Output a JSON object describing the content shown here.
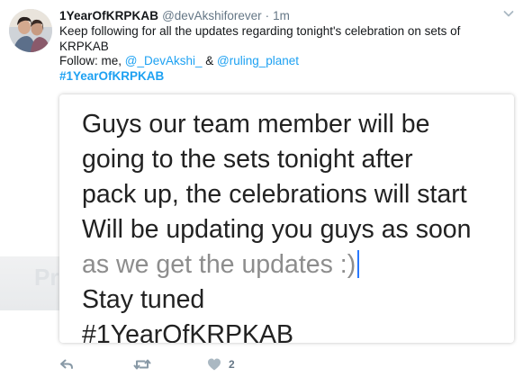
{
  "tweet": {
    "display_name": "1YearOfKRPKAB",
    "handle": "@devAkshiforever",
    "separator": "·",
    "time": "1m",
    "text_line1": "Keep following for all the updates regarding tonight's celebration on sets of",
    "text_line2": "KRPKAB",
    "follow_prefix": "Follow: me, ",
    "mention1": "@_DevAkshi_",
    "and": " & ",
    "mention2": "@ruling_planet",
    "hashtag": "#1YearOfKRPKAB"
  },
  "media": {
    "lines": [
      "Guys our team member will be",
      "going to the sets tonight after",
      "pack up, the celebrations will start",
      "Will be updating you guys as soon",
      "as we get the updates :)",
      "Stay tuned",
      "#1YearOfKRPKAB"
    ]
  },
  "background": {
    "partial_text": "Pr"
  },
  "actions": {
    "retweet_count": "",
    "like_count": "2"
  },
  "colors": {
    "link": "#1da1f2",
    "muted": "#657786",
    "like_icon": "#aab8c2"
  },
  "icons": [
    "reply-icon",
    "retweet-icon",
    "heart-icon",
    "chevron-down-icon"
  ]
}
